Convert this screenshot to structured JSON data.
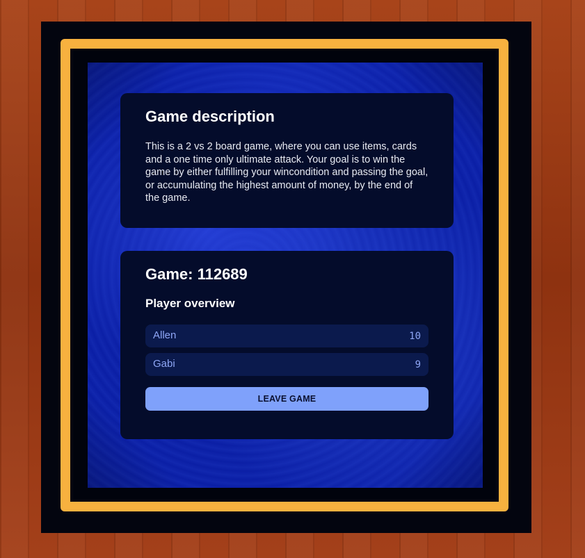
{
  "description": {
    "title": "Game description",
    "text": "This is a 2 vs 2 board game, where you can use items, cards and a one time only ultimate attack. Your goal is to win the game by either fulfilling your wincondition and passing the goal, or accumulating the highest amount of money, by the end of the game."
  },
  "game": {
    "title": "Game: 112689",
    "overview_title": "Player overview",
    "players": [
      {
        "name": "Allen",
        "score": "10"
      },
      {
        "name": "Gabi",
        "score": "9"
      }
    ],
    "leave_label": "LEAVE GAME"
  },
  "colors": {
    "frame_gold": "#f7b13f",
    "board_blue": "#0b1fa6",
    "card_bg": "#040c2b",
    "button_bg": "#7fa1fb",
    "player_text": "#8ea6f5"
  }
}
